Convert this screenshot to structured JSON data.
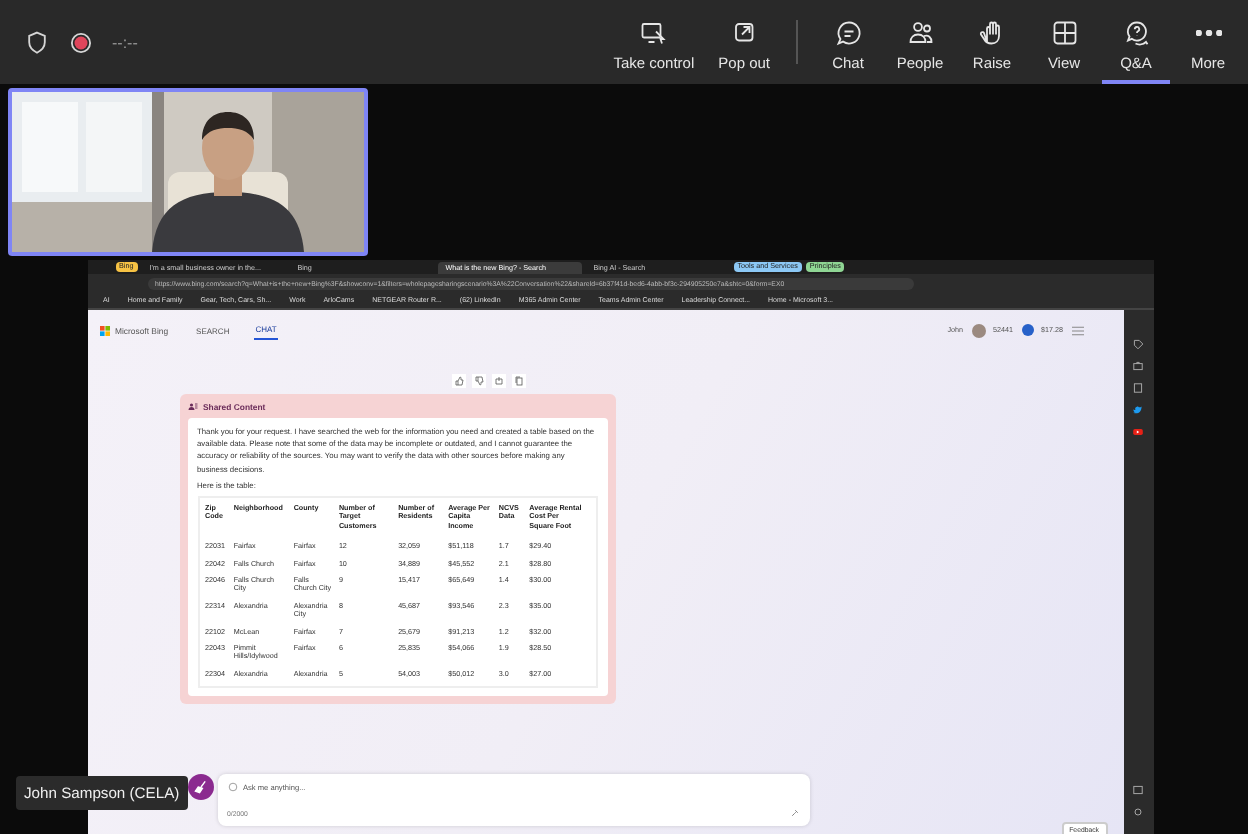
{
  "meeting_bar": {
    "timer": "--:--",
    "actions": [
      {
        "label": "Take control",
        "selected": false
      },
      {
        "label": "Pop out",
        "selected": false
      },
      {
        "label": "Chat",
        "selected": false
      },
      {
        "label": "People",
        "selected": false
      },
      {
        "label": "Raise",
        "selected": false
      },
      {
        "label": "View",
        "selected": false
      },
      {
        "label": "Q&A",
        "selected": true
      },
      {
        "label": "More",
        "selected": false
      }
    ]
  },
  "presenter_label": "John Sampson (CELA)",
  "browser": {
    "tabs": [
      {
        "kind": "group",
        "label": "Bing",
        "color": "#f6c244"
      },
      {
        "kind": "tab",
        "label": "I'm a small business owner in the...",
        "selected": false
      },
      {
        "kind": "tab",
        "label": "Bing",
        "selected": false
      },
      {
        "kind": "tab",
        "label": "What is the new Bing? - Search",
        "selected": true
      },
      {
        "kind": "tab",
        "label": "Bing AI - Search",
        "selected": false
      },
      {
        "kind": "group",
        "label": "Tools and Services",
        "color": "#8cc8f5"
      },
      {
        "kind": "group",
        "label": "Principles",
        "color": "#8fd694"
      }
    ],
    "address": "https://www.bing.com/search?q=What+is+the+new+Bing%3F&showconv=1&filters=wholepagesharingscenario%3A%22Conversation%22&shareId=6b37f41d-bed6-4abb-bf3c-294905250e7a&shtc=0&form=EX0",
    "bookmarks": [
      "AI",
      "Home and Family",
      "Gear, Tech, Cars, Sh...",
      "Work",
      "ArloCams",
      "NETGEAR Router R...",
      "(62) LinkedIn",
      "M365 Admin Center",
      "Teams Admin Center",
      "Leadership Connect...",
      "Home - Microsoft 3..."
    ],
    "page": {
      "brand": "Microsoft Bing",
      "nav": [
        {
          "label": "SEARCH",
          "selected": false
        },
        {
          "label": "CHAT",
          "selected": true
        }
      ],
      "user": "John",
      "points": "52441",
      "balance": "$17.28",
      "card": {
        "title": "Shared Content",
        "intro": "Thank you for your request. I have searched the web for the information you need and created a table based on the available data. Please note that some of the data may be incomplete or outdated, and I cannot guarantee the accuracy or reliability of the sources. You may want to verify the data with other sources before making any business decisions.",
        "table_caption": "Here is the table:",
        "table": {
          "columns": [
            "Zip Code",
            "Neighborhood",
            "County",
            "Number of Target Customers",
            "Number of Residents",
            "Average Per Capita Income",
            "NCVS Data",
            "Average Rental Cost Per Square Foot"
          ],
          "rows": [
            [
              "22031",
              "Fairfax",
              "Fairfax",
              "12",
              "32,059",
              "$51,118",
              "1.7",
              "$29.40"
            ],
            [
              "22042",
              "Falls Church",
              "Fairfax",
              "10",
              "34,889",
              "$45,552",
              "2.1",
              "$28.80"
            ],
            [
              "22046",
              "Falls Church City",
              "Falls Church City",
              "9",
              "15,417",
              "$65,649",
              "1.4",
              "$30.00"
            ],
            [
              "22314",
              "Alexandria",
              "Alexandria City",
              "8",
              "45,687",
              "$93,546",
              "2.3",
              "$35.00"
            ],
            [
              "22102",
              "McLean",
              "Fairfax",
              "7",
              "25,679",
              "$91,213",
              "1.2",
              "$32.00"
            ],
            [
              "22043",
              "Pimmit Hills/Idylwood",
              "Fairfax",
              "6",
              "25,835",
              "$54,066",
              "1.9",
              "$28.50"
            ],
            [
              "22304",
              "Alexandria",
              "Alexandria",
              "5",
              "54,003",
              "$50,012",
              "3.0",
              "$27.00"
            ]
          ]
        }
      },
      "chat_input": {
        "placeholder": "Ask me anything...",
        "counter": "0/2000"
      },
      "feedback": "Feedback"
    }
  }
}
